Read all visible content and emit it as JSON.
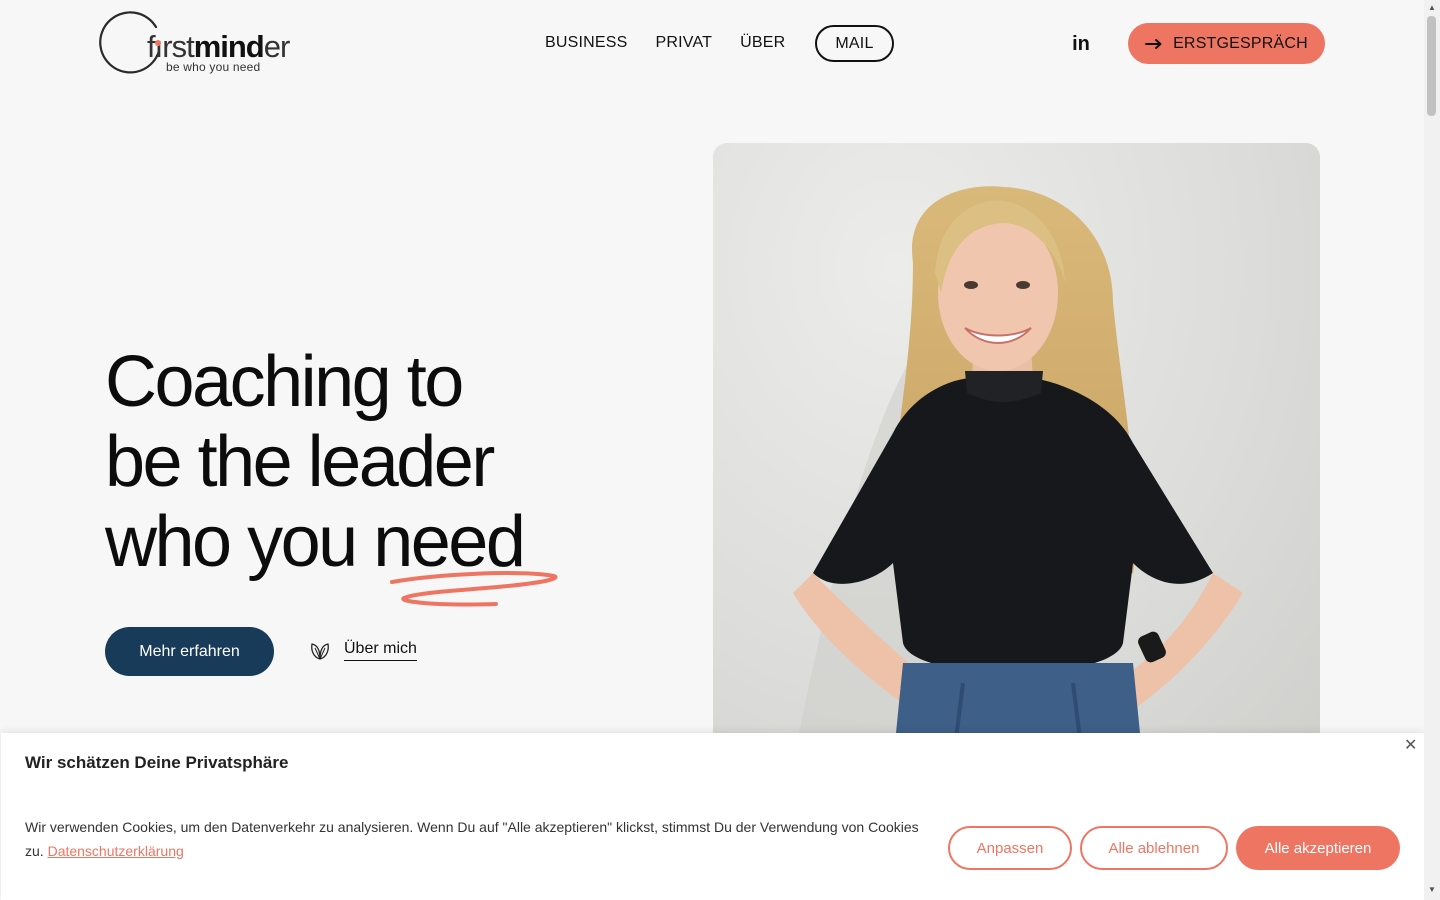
{
  "header": {
    "logo": {
      "wordmark_light_1": "f",
      "wordmark_i": "ı",
      "wordmark_light_2": "rst",
      "wordmark_bold": "mind",
      "wordmark_light_3": "er",
      "tagline": "be who you need"
    },
    "nav": [
      {
        "label": "BUSINESS"
      },
      {
        "label": "PRIVAT"
      },
      {
        "label": "ÜBER"
      },
      {
        "label": "MAIL"
      }
    ],
    "social_icon": "linkedin-icon",
    "social_label": "in",
    "cta_label": "ERSTGESPRÄCH",
    "cta_icon": "arrow-right-icon"
  },
  "hero": {
    "line1": "Coaching to",
    "line2": "be the leader",
    "line3_a": "who you ",
    "line3_b": "need",
    "primary_button": "Mehr erfahren",
    "secondary_link": "Über mich",
    "secondary_icon": "leaf-icon"
  },
  "cookie_banner": {
    "title": "Wir schätzen Deine Privatsphäre",
    "text": "Wir verwenden Cookies, um den Datenverkehr zu analysieren. Wenn Du auf \"Alle akzeptieren\" klickst, stimmst Du der Verwendung von Cookies zu. ",
    "privacy_link": "Datenschutzerklärung",
    "close_label": "✕",
    "buttons": {
      "customize": "Anpassen",
      "reject": "Alle ablehnen",
      "accept": "Alle akzeptieren"
    }
  },
  "colors": {
    "accent": "#ef7563",
    "primary_button": "#183b59",
    "background": "#f7f7f7"
  }
}
